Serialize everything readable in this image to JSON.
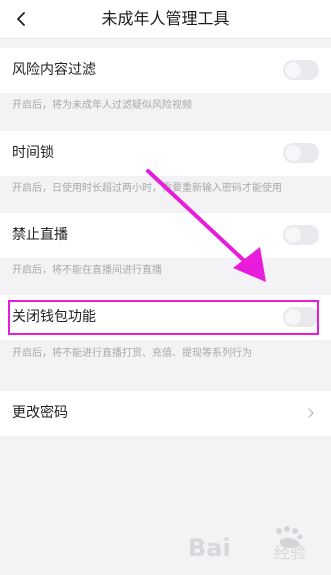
{
  "header": {
    "back_icon": "chevron-left-icon",
    "title": "未成年人管理工具"
  },
  "settings": [
    {
      "label": "风险内容过滤",
      "enabled": false,
      "description": "开启后，将为未成年人过滤疑似风险视频"
    },
    {
      "label": "时间锁",
      "enabled": false,
      "description": "开启后，日使用时长超过两小时，需要重新输入密码才能使用"
    },
    {
      "label": "禁止直播",
      "enabled": false,
      "description": "开启后，将不能在直播间进行直播"
    },
    {
      "label": "关闭钱包功能",
      "enabled": false,
      "description": "开启后，将不能进行直播打赏、充值、提现等系列行为"
    }
  ],
  "change_password": {
    "label": "更改密码",
    "icon": "chevron-right-icon"
  },
  "annotation": {
    "color": "#e81ddc"
  },
  "watermark": {
    "text": "Bai 经验"
  }
}
